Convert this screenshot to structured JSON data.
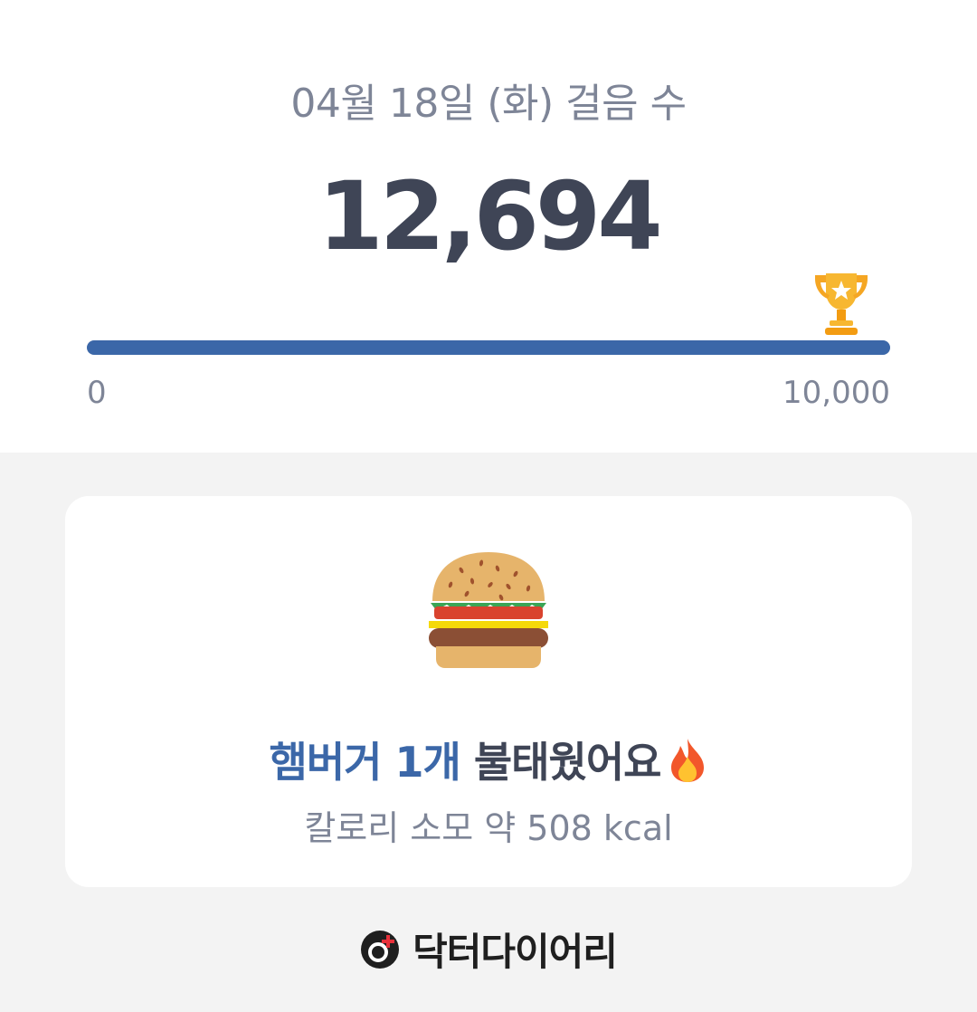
{
  "header": {
    "date_title": "04월 18일 (화) 걸음 수",
    "step_count": "12,694"
  },
  "progress": {
    "min_label": "0",
    "max_label": "10,000",
    "fraction": 1.0,
    "icon": "trophy-icon",
    "bar_color": "#3b67a8"
  },
  "calorie_card": {
    "icon": "hamburger-icon",
    "food_highlight": "햄버거 1개",
    "burn_text": " 불태웠어요",
    "fire_icon": "fire-icon",
    "kcal_text": "칼로리 소모 약 508 kcal"
  },
  "brand": {
    "logo_icon": "doctor-diary-logo-icon",
    "name": "닥터다이어리"
  },
  "colors": {
    "accent": "#3b67a8",
    "text_dark": "#3f4556",
    "text_gray": "#7e8597"
  }
}
